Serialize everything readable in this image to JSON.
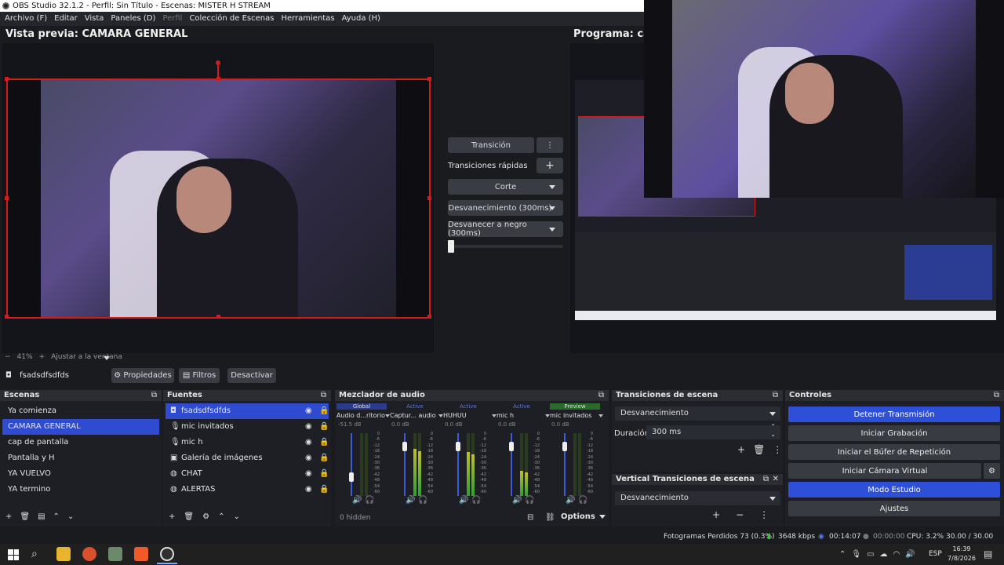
{
  "window": {
    "title": "OBS Studio 32.1.2 - Perfil: Sin Título - Escenas: MISTER H STREAM"
  },
  "menu": [
    "Archivo (F)",
    "Editar",
    "Vista",
    "Paneles (D)",
    "Perfil",
    "Colección de Escenas",
    "Herramientas",
    "Ayuda (H)"
  ],
  "preview": {
    "title": "Vista previa: CAMARA GENERAL",
    "zoom": "41%",
    "fit": "Ajustar a la ventana"
  },
  "program": {
    "title": "Programa: cap"
  },
  "transition_panel": {
    "transition_label": "Transición",
    "quick_label": "Transiciones rápidas",
    "items": [
      "Corte",
      "Desvanecimiento (300ms)",
      "Desvanecer a negro (300ms)"
    ]
  },
  "source_bar": {
    "source": "fsadsdfsdfds",
    "properties": "Propiedades",
    "filters": "Filtros",
    "deactivate": "Desactivar"
  },
  "scenes": {
    "title": "Escenas",
    "items": [
      "Ya comienza",
      "CAMARA GENERAL",
      "cap de pantalla",
      "Pantalla y H",
      "YA VUELVO",
      "YA termino"
    ],
    "active_index": 1
  },
  "sources": {
    "title": "Fuentes",
    "items": [
      {
        "name": "fsadsdfsdfds",
        "icon": "camera-icon"
      },
      {
        "name": "mic invitados",
        "icon": "mic-icon"
      },
      {
        "name": "mic h",
        "icon": "mic-icon"
      },
      {
        "name": "Galería de imágenes",
        "icon": "image-icon"
      },
      {
        "name": "CHAT",
        "icon": "globe-icon"
      },
      {
        "name": "ALERTAS",
        "icon": "globe-icon"
      }
    ]
  },
  "mixer": {
    "title": "Mezclador de audio",
    "channels": [
      {
        "tag": "Global",
        "name": "Audio d...ritorio",
        "db": "-51.5 dB",
        "level": 0.0,
        "fader": 0.3
      },
      {
        "tag": "Active",
        "name": "Captur... audio",
        "db": "0.0 dB",
        "level": 0.75,
        "fader": 0.85
      },
      {
        "tag": "Active",
        "name": "HUHUU",
        "db": "0.0 dB",
        "level": 0.7,
        "fader": 0.85
      },
      {
        "tag": "Active",
        "name": "mic h",
        "db": "0.0 dB",
        "level": 0.4,
        "fader": 0.85
      },
      {
        "tag": "Preview",
        "name": "mic invitados",
        "db": "0.0 dB",
        "level": 0.0,
        "fader": 0.85
      }
    ],
    "hidden_label": "0 hidden",
    "options_label": "Options",
    "scale": [
      "0",
      "-6",
      "-12",
      "-18",
      "-24",
      "-30",
      "-36",
      "-42",
      "-48",
      "-54",
      "-60"
    ]
  },
  "scene_transitions": {
    "title": "Transiciones de escena",
    "selected": "Desvanecimiento",
    "duration_label": "Duración",
    "duration_value": "300 ms"
  },
  "vertical_transitions": {
    "title": "Vertical Transiciones de escena",
    "selected": "Desvanecimiento"
  },
  "controls": {
    "title": "Controles",
    "buttons": [
      "Detener Transmisión",
      "Iniciar Grabación",
      "Iniciar el Búfer de Repetición",
      "Iniciar Cámara Virtual",
      "Modo Estudio",
      "Ajustes"
    ]
  },
  "status": {
    "dropped": "Fotogramas Perdidos 73 (0.3%)",
    "bitrate": "3648 kbps",
    "stream_time": "00:14:07",
    "rec_time": "00:00:00",
    "cpu": "CPU: 3.2%",
    "fps": "30.00 / 30.00 FPS"
  },
  "taskbar": {
    "lang": "ESP",
    "time": "16:39",
    "date": "7/8/2026"
  },
  "colors": {
    "selection": "#d01e1e",
    "accent": "#2e4fd8",
    "preview_tag": "#2a6a2a"
  }
}
